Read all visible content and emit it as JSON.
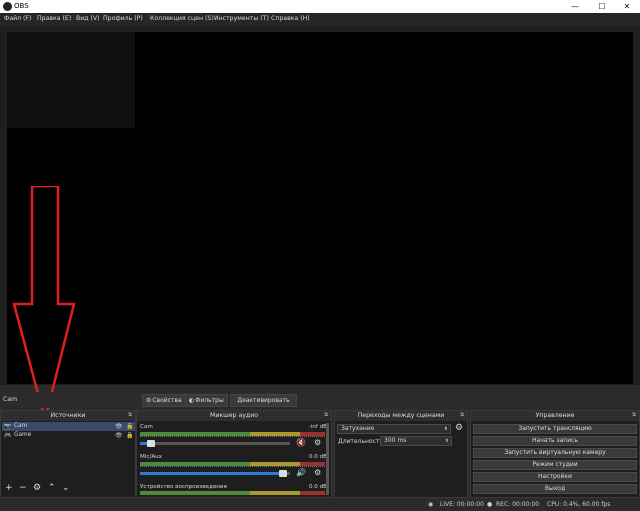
{
  "window": {
    "title": "OBS",
    "minimize": "—",
    "maximize": "☐",
    "close": "✕"
  },
  "menu": [
    "Файл (F)",
    "Правка (E)",
    "Вид (V)",
    "Профиль (P)",
    "Коллекция сцен (S)",
    "Инструменты (T)",
    "Справка (H)"
  ],
  "toolbar": {
    "source_name": "Cam",
    "properties_label": "Свойства",
    "filters_label": "Фильтры",
    "deactivate_label": "Деактивировать"
  },
  "sources": {
    "title": "Источники",
    "items": [
      {
        "name": "Cam",
        "selected": true,
        "icon": "camera-icon"
      },
      {
        "name": "Game",
        "selected": false,
        "icon": "gamepad-icon"
      }
    ]
  },
  "mixer": {
    "title": "Микшер аудио",
    "channels": [
      {
        "name": "Cam",
        "db": "-inf dB",
        "volume": 0.05,
        "muted": true
      },
      {
        "name": "Mic/Aux",
        "db": "0.0 dB",
        "volume": 0.98,
        "muted": false
      },
      {
        "name": "Устройство воспроизведения",
        "db": "0.0 dB",
        "volume": 0.98,
        "muted": false
      }
    ]
  },
  "transitions": {
    "title": "Переходы между сценами",
    "selected": "Затухание",
    "duration_label": "Длительность",
    "duration_value": "300 ms"
  },
  "controls": {
    "title": "Управление",
    "buttons": [
      "Запустить трансляцию",
      "Начать запись",
      "Запустить виртуальную камеру",
      "Режим студии",
      "Настройки",
      "Выход"
    ]
  },
  "status": {
    "live": "LIVE: 00:00:00",
    "rec": "REC: 00:00:00",
    "cpu": "CPU: 0.4%, 60.00 fps"
  },
  "colors": {
    "accent": "#2c7bd6",
    "arrow": "#e02020",
    "muted": "#e03030"
  }
}
